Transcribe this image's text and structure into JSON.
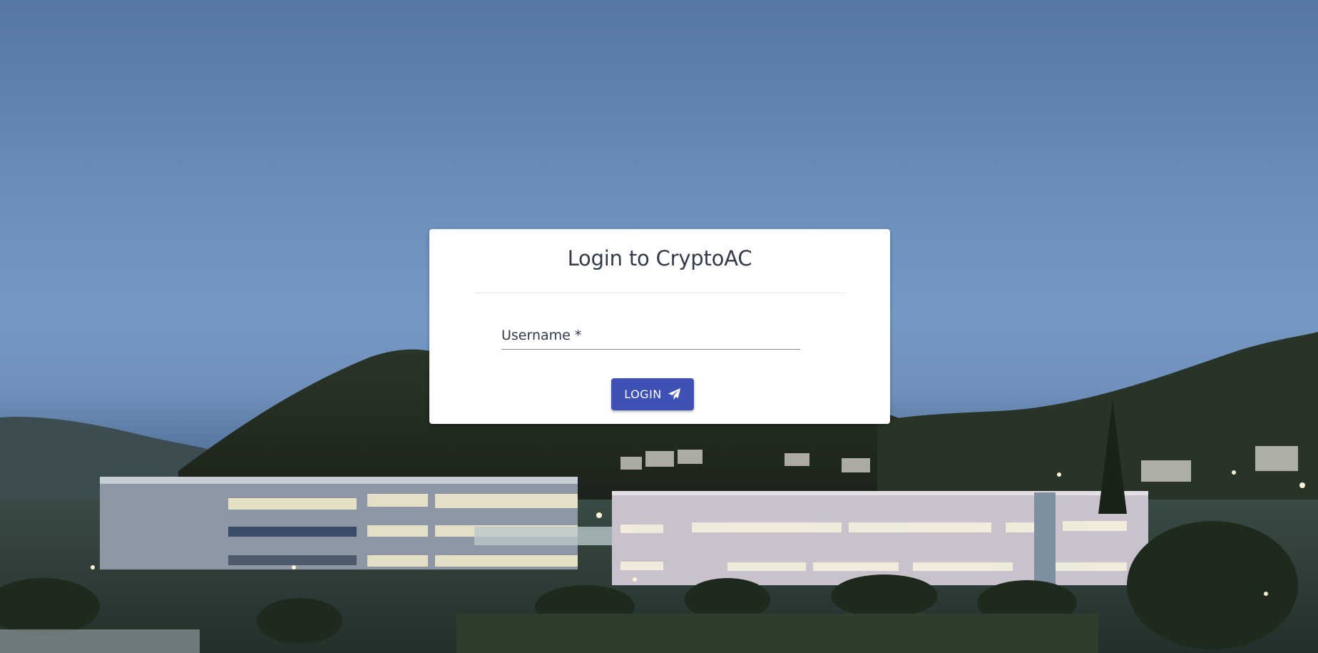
{
  "login": {
    "title": "Login to CryptoAC",
    "username_placeholder": "Username *",
    "username_value": "",
    "button_label": "LOGIN",
    "button_icon": "paper-plane-icon"
  },
  "colors": {
    "card_bg": "#ffffff",
    "primary": "#3f51b5",
    "text": "#333b49",
    "sky": "#6a8fb9"
  }
}
